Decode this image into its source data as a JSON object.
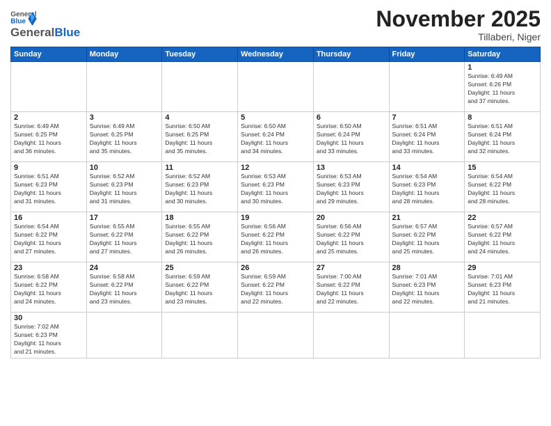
{
  "logo": {
    "general": "General",
    "blue": "Blue"
  },
  "title": "November 2025",
  "subtitle": "Tillaberi, Niger",
  "days_header": [
    "Sunday",
    "Monday",
    "Tuesday",
    "Wednesday",
    "Thursday",
    "Friday",
    "Saturday"
  ],
  "weeks": [
    [
      {
        "num": "",
        "info": ""
      },
      {
        "num": "",
        "info": ""
      },
      {
        "num": "",
        "info": ""
      },
      {
        "num": "",
        "info": ""
      },
      {
        "num": "",
        "info": ""
      },
      {
        "num": "",
        "info": ""
      },
      {
        "num": "1",
        "info": "Sunrise: 6:49 AM\nSunset: 6:26 PM\nDaylight: 11 hours\nand 37 minutes."
      }
    ],
    [
      {
        "num": "2",
        "info": "Sunrise: 6:49 AM\nSunset: 6:25 PM\nDaylight: 11 hours\nand 36 minutes."
      },
      {
        "num": "3",
        "info": "Sunrise: 6:49 AM\nSunset: 6:25 PM\nDaylight: 11 hours\nand 35 minutes."
      },
      {
        "num": "4",
        "info": "Sunrise: 6:50 AM\nSunset: 6:25 PM\nDaylight: 11 hours\nand 35 minutes."
      },
      {
        "num": "5",
        "info": "Sunrise: 6:50 AM\nSunset: 6:24 PM\nDaylight: 11 hours\nand 34 minutes."
      },
      {
        "num": "6",
        "info": "Sunrise: 6:50 AM\nSunset: 6:24 PM\nDaylight: 11 hours\nand 33 minutes."
      },
      {
        "num": "7",
        "info": "Sunrise: 6:51 AM\nSunset: 6:24 PM\nDaylight: 11 hours\nand 33 minutes."
      },
      {
        "num": "8",
        "info": "Sunrise: 6:51 AM\nSunset: 6:24 PM\nDaylight: 11 hours\nand 32 minutes."
      }
    ],
    [
      {
        "num": "9",
        "info": "Sunrise: 6:51 AM\nSunset: 6:23 PM\nDaylight: 11 hours\nand 31 minutes."
      },
      {
        "num": "10",
        "info": "Sunrise: 6:52 AM\nSunset: 6:23 PM\nDaylight: 11 hours\nand 31 minutes."
      },
      {
        "num": "11",
        "info": "Sunrise: 6:52 AM\nSunset: 6:23 PM\nDaylight: 11 hours\nand 30 minutes."
      },
      {
        "num": "12",
        "info": "Sunrise: 6:53 AM\nSunset: 6:23 PM\nDaylight: 11 hours\nand 30 minutes."
      },
      {
        "num": "13",
        "info": "Sunrise: 6:53 AM\nSunset: 6:23 PM\nDaylight: 11 hours\nand 29 minutes."
      },
      {
        "num": "14",
        "info": "Sunrise: 6:54 AM\nSunset: 6:23 PM\nDaylight: 11 hours\nand 28 minutes."
      },
      {
        "num": "15",
        "info": "Sunrise: 6:54 AM\nSunset: 6:22 PM\nDaylight: 11 hours\nand 28 minutes."
      }
    ],
    [
      {
        "num": "16",
        "info": "Sunrise: 6:54 AM\nSunset: 6:22 PM\nDaylight: 11 hours\nand 27 minutes."
      },
      {
        "num": "17",
        "info": "Sunrise: 6:55 AM\nSunset: 6:22 PM\nDaylight: 11 hours\nand 27 minutes."
      },
      {
        "num": "18",
        "info": "Sunrise: 6:55 AM\nSunset: 6:22 PM\nDaylight: 11 hours\nand 26 minutes."
      },
      {
        "num": "19",
        "info": "Sunrise: 6:56 AM\nSunset: 6:22 PM\nDaylight: 11 hours\nand 26 minutes."
      },
      {
        "num": "20",
        "info": "Sunrise: 6:56 AM\nSunset: 6:22 PM\nDaylight: 11 hours\nand 25 minutes."
      },
      {
        "num": "21",
        "info": "Sunrise: 6:57 AM\nSunset: 6:22 PM\nDaylight: 11 hours\nand 25 minutes."
      },
      {
        "num": "22",
        "info": "Sunrise: 6:57 AM\nSunset: 6:22 PM\nDaylight: 11 hours\nand 24 minutes."
      }
    ],
    [
      {
        "num": "23",
        "info": "Sunrise: 6:58 AM\nSunset: 6:22 PM\nDaylight: 11 hours\nand 24 minutes."
      },
      {
        "num": "24",
        "info": "Sunrise: 6:58 AM\nSunset: 6:22 PM\nDaylight: 11 hours\nand 23 minutes."
      },
      {
        "num": "25",
        "info": "Sunrise: 6:59 AM\nSunset: 6:22 PM\nDaylight: 11 hours\nand 23 minutes."
      },
      {
        "num": "26",
        "info": "Sunrise: 6:59 AM\nSunset: 6:22 PM\nDaylight: 11 hours\nand 22 minutes."
      },
      {
        "num": "27",
        "info": "Sunrise: 7:00 AM\nSunset: 6:22 PM\nDaylight: 11 hours\nand 22 minutes."
      },
      {
        "num": "28",
        "info": "Sunrise: 7:01 AM\nSunset: 6:23 PM\nDaylight: 11 hours\nand 22 minutes."
      },
      {
        "num": "29",
        "info": "Sunrise: 7:01 AM\nSunset: 6:23 PM\nDaylight: 11 hours\nand 21 minutes."
      }
    ],
    [
      {
        "num": "30",
        "info": "Sunrise: 7:02 AM\nSunset: 6:23 PM\nDaylight: 11 hours\nand 21 minutes."
      },
      {
        "num": "",
        "info": ""
      },
      {
        "num": "",
        "info": ""
      },
      {
        "num": "",
        "info": ""
      },
      {
        "num": "",
        "info": ""
      },
      {
        "num": "",
        "info": ""
      },
      {
        "num": "",
        "info": ""
      }
    ]
  ]
}
